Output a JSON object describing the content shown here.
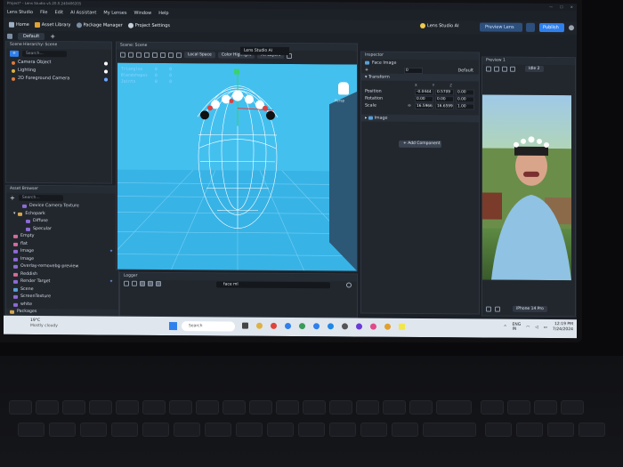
{
  "window": {
    "title": "Project* - Lens Studio v5.20.0.240406205"
  },
  "menu": [
    "Lens Studio",
    "File",
    "Edit",
    "AI Assistant",
    "My Lenses",
    "Window",
    "Help"
  ],
  "toolbar": {
    "home": "Home",
    "asset_library": "Asset Library",
    "package_manager": "Package Manager",
    "project_settings": "Project Settings",
    "lens_studio_ai": "Lens Studio AI",
    "preview_lens": "Preview Lens",
    "publish": "Publish"
  },
  "workspace": {
    "tab": "Default"
  },
  "hierarchy": {
    "title": "Scene Hierarchy: Scene",
    "search": "Search...",
    "items": [
      "Camera Object",
      "Lighting",
      "2D Foreground Camera"
    ]
  },
  "scene": {
    "title": "Scene: Scene",
    "space": "Local Space",
    "highlight": "Color Highlight",
    "layers": "All Layers",
    "stats": [
      {
        "label": "Triangles",
        "value": "0",
        "extra": "0"
      },
      {
        "label": "Blendshapes",
        "value": "0",
        "extra": "0"
      },
      {
        "label": "Joints",
        "value": "0",
        "extra": "0"
      }
    ],
    "persp": "Persp"
  },
  "ai_tab": "Lens Studio AI",
  "assets": {
    "title": "Asset Browser",
    "search": "Search...",
    "items": [
      "Device Camera Texture",
      "Echopark",
      "Diffuse",
      "Specular",
      "Empty",
      "flat",
      "Image",
      "Image",
      "Overlay-removebg-preview",
      "Reddish",
      "Render Target",
      "Scene",
      "ScreenTexture",
      "white",
      "Packages"
    ]
  },
  "logger": {
    "title": "Logger",
    "search": "face ml"
  },
  "inspector": {
    "title": "Inspector",
    "object": "Face Image",
    "layer_value": "0",
    "default_label": "Default",
    "transform": "Transform",
    "axes": [
      "X",
      "Y",
      "Z"
    ],
    "position": {
      "label": "Position",
      "values": [
        "-0.0444",
        "0.5709",
        "0.00"
      ]
    },
    "rotation": {
      "label": "Rotation",
      "values": [
        "0.00",
        "0.00",
        "0.00"
      ]
    },
    "scale": {
      "label": "Scale",
      "values": [
        "16.5966",
        "16.6599",
        "1.00"
      ]
    },
    "image_component": "Image",
    "add_component": "+ Add Component"
  },
  "preview": {
    "title": "Preview 1",
    "mode": "Idle 2",
    "device": "iPhone 14 Pro"
  },
  "taskbar": {
    "temp": "19°C",
    "weather": "Mostly cloudy",
    "search": "Search",
    "lang": "ENG",
    "region": "IN",
    "time": "12:19 PM",
    "date": "7/24/2024"
  },
  "colors": {
    "accent": "#2f80ed",
    "viewport_floor": "#3bb5e8",
    "wireframe": "#ffffff"
  }
}
